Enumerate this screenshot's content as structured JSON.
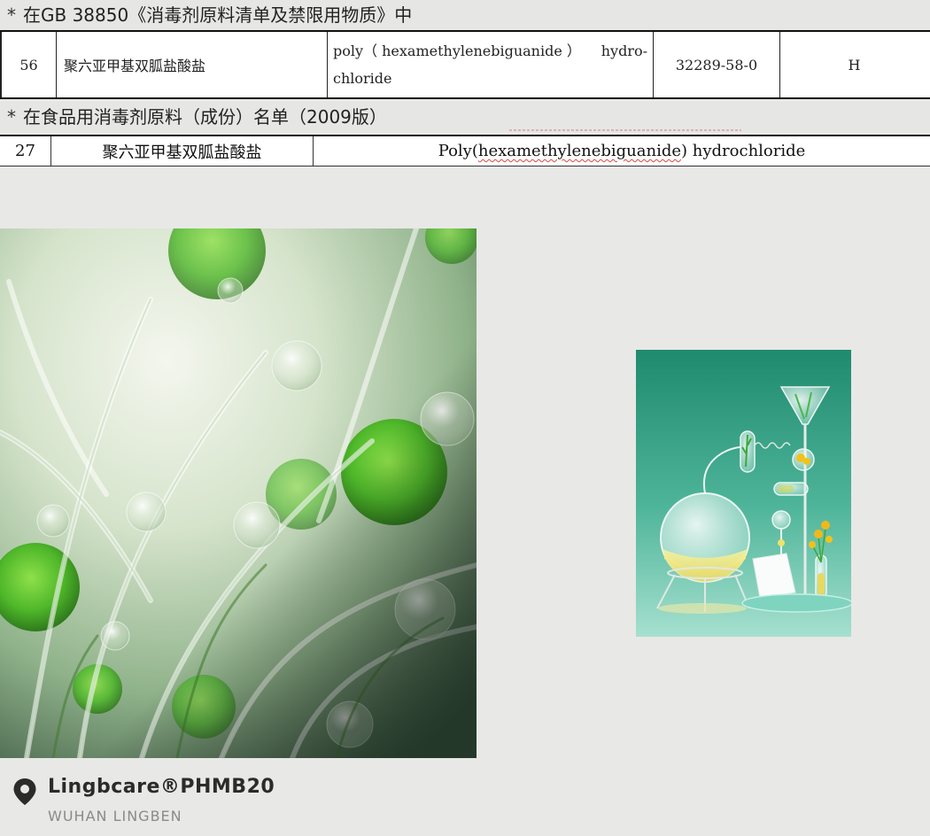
{
  "section1": {
    "marker": "*",
    "heading": "在GB 38850《消毒剂原料清单及禁限用物质》中",
    "row": {
      "number": "56",
      "name_cn": "聚六亚甲基双胍盐酸盐",
      "name_en_line1_a": "poly（ hexamethylenebiguanide ）",
      "name_en_line1_b": "hydro-",
      "name_en_line2": "chloride",
      "cas": "32289-58-0",
      "code": "H"
    }
  },
  "section2": {
    "marker": "*",
    "heading": "在食品用消毒剂原料（成份）名单（2009版）",
    "row": {
      "number": "27",
      "name_cn": "聚六亚甲基双胍盐酸盐",
      "name_en_pre": "Poly(",
      "name_en_mid": "hexamethylenebiguanide",
      "name_en_post": ") hydrochloride"
    }
  },
  "footer": {
    "icon": "location-pin-icon",
    "brand": "Lingbcare®PHMB20",
    "company": "WUHAN LINGBEN"
  },
  "colors": {
    "page_bg": "#e8e8e6",
    "brand_text": "#2b2b2b",
    "company_text": "#8a8a8a"
  }
}
